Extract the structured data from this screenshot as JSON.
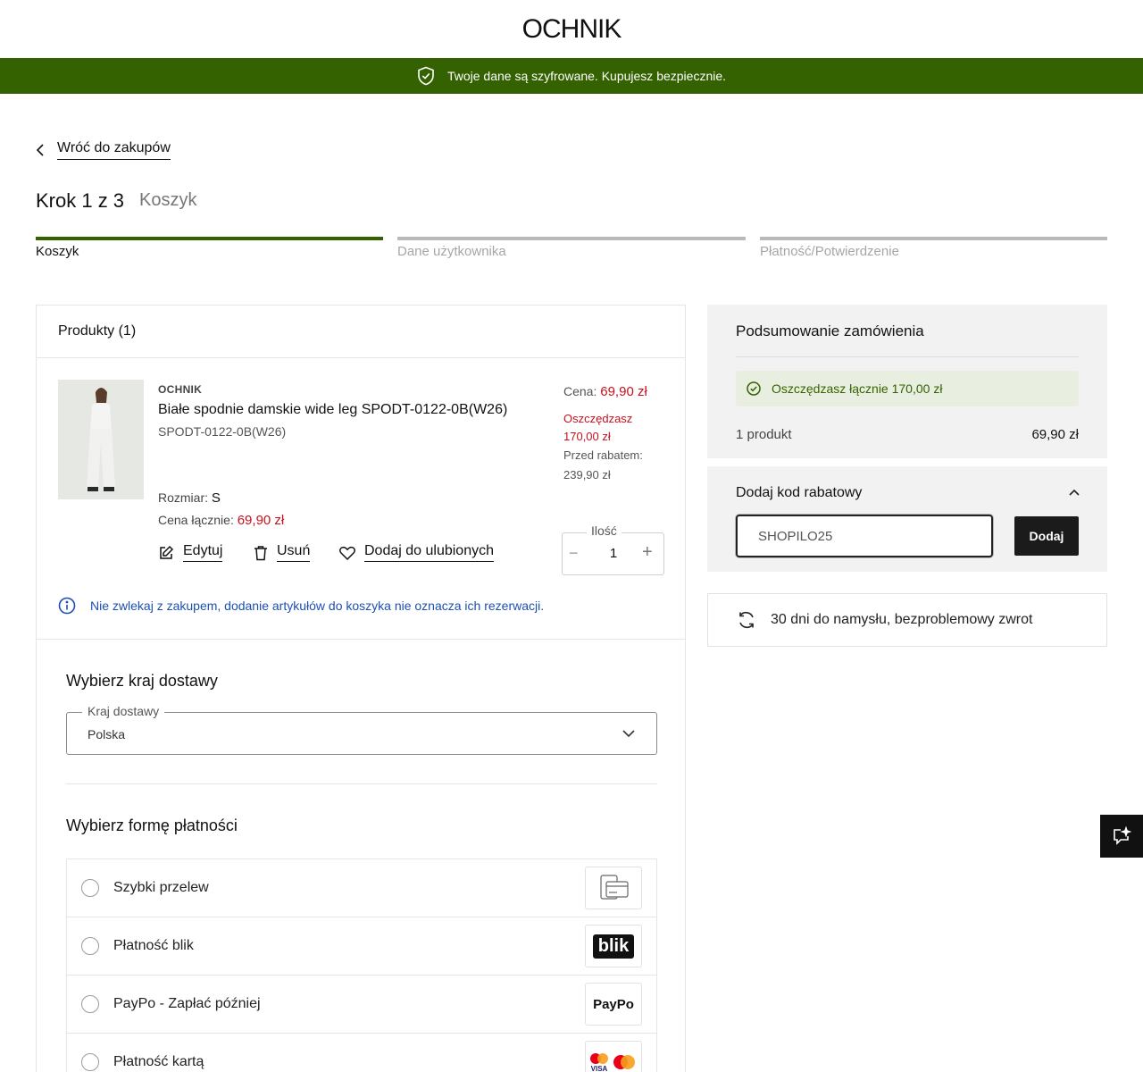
{
  "header": {
    "logo": "OCHNIK"
  },
  "secure_bar": {
    "text": "Twoje dane są szyfrowane. Kupujesz bezpiecznie."
  },
  "nav": {
    "back_label": "Wróć do zakupów"
  },
  "step": {
    "title": "Krok 1 z 3",
    "subtitle": "Koszyk",
    "steps": [
      {
        "label": "Koszyk",
        "active": true
      },
      {
        "label": "Dane użytkownika",
        "active": false
      },
      {
        "label": "Płatność/Potwierdzenie",
        "active": false
      }
    ]
  },
  "products": {
    "title": "Produkty (1)",
    "item": {
      "brand": "OCHNIK",
      "name": "Białe spodnie damskie wide leg SPODT-0122-0B(W26)",
      "sku": "SPODT-0122-0B(W26)",
      "size_label": "Rozmiar:",
      "size_value": "S",
      "total_label": "Cena łącznie:",
      "total_value": "69,90 zł",
      "price_label": "Cena:",
      "price_value": "69,90 zł",
      "save_label": "Oszczędzasz",
      "save_value": "170,00 zł",
      "before_label": "Przed rabatem:",
      "before_value": "239,90 zł",
      "qty_label": "Ilość",
      "qty_value": "1"
    },
    "actions": {
      "edit": "Edytuj",
      "remove": "Usuń",
      "favorite": "Dodaj do ulubionych"
    },
    "info": "Nie zwlekaj z zakupem, dodanie artykułów do koszyka nie oznacza ich rezerwacji."
  },
  "delivery": {
    "title": "Wybierz kraj dostawy",
    "field_label": "Kraj dostawy",
    "value": "Polska"
  },
  "payment": {
    "title": "Wybierz formę płatności",
    "options": [
      {
        "label": "Szybki przelew",
        "logo": "bank-transfer-icon"
      },
      {
        "label": "Płatność blik",
        "logo": "blik-logo",
        "logo_text": "blik"
      },
      {
        "label": "PayPo - Zapłać później",
        "logo": "paypo-logo",
        "logo_text": "PayPo"
      },
      {
        "label": "Płatność kartą",
        "logo": "card-logos",
        "logo_text": "VISA"
      }
    ]
  },
  "summary": {
    "title": "Podsumowanie zamówienia",
    "saving": "Oszczędzasz łącznie 170,00 zł",
    "count": "1 produkt",
    "price": "69,90 zł"
  },
  "coupon": {
    "title": "Dodaj kod rabatowy",
    "value": "SHOPILO25",
    "button": "Dodaj"
  },
  "returns": {
    "text": "30 dni do namysłu, bezproblemowy zwrot"
  },
  "colors": {
    "brand_green": "#356200",
    "price_red": "#c8101e",
    "info_blue": "#1c4fb3"
  }
}
